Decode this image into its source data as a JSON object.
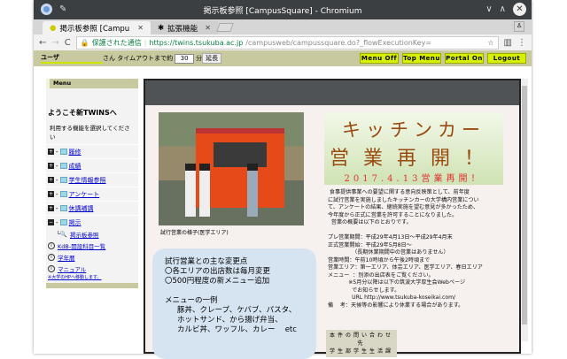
{
  "window": {
    "title": "掲示板参照 [CampusSquare] - Chromium"
  },
  "tabs": [
    {
      "label": "掲示板参照 [Campu"
    },
    {
      "label": "拡張機能"
    }
  ],
  "address": {
    "secure_label": "保護された通信",
    "host": "https://twins.tsukuba.ac.jp",
    "path": "/campusweb/campussquare.do?_flowExecutionKey="
  },
  "header": {
    "user": "ユーザ",
    "san": "さん",
    "timeout_label": "タイムアウトまで約",
    "timeout_value": "30",
    "minutes": "分",
    "extend": "延長",
    "buttons": [
      "Menu Off",
      "Top Menu",
      "Portal On",
      "Logout"
    ]
  },
  "sidebar": {
    "menu": "Menu",
    "welcome": "ようこそ新TWINSへ",
    "instruction": "利用する機能を選択してください",
    "items": [
      "履修",
      "成績",
      "学生情報参照",
      "アンケート",
      "休講補講",
      "掲示"
    ],
    "subitem": "掲示板参照",
    "links": [
      "KdB-開設科目一覧",
      "学年暦",
      "マニュアル"
    ],
    "note": "※大学のHPへ移動します。"
  },
  "content": {
    "caption": "試行営業の様子(医学エリア)",
    "banner": {
      "line1": "キッチンカー",
      "line2": "営業再開！",
      "line3": "2017.4.13営業再開！"
    },
    "body": [
      " 食事提供事業への要望に関する意向反映策として、前年度",
      "に試行営業を実施しましたキッチンカーの大学構内営業につい",
      "て、アンケートの結果、継続実施を望む意見が多かったため、",
      "今年度から正式に営業を許可することになりました。",
      "  営業の概要は以下のとおりです。",
      "",
      "プレ営業期間：平成29年4月13日～平成29年4月末",
      "正式営業開始：平成29年5月8日～",
      "              （長期休業期間中の営業はありません）",
      "営業時間：午前10時頃から午後2時頃まで",
      "営業エリア：第一エリア、体芸エリア、医学エリア、春日エリア",
      "メニュー  ：別添の出店表をご覧ください。",
      "            ※5月分以降は以下の筑波大学厚生会Webページ",
      "              でお知らせします。",
      "              URL http://www.tsukuba-koseikai.com/",
      "備    考：天候等の影響により休業する場合があります。"
    ],
    "contact": [
      "本件の問い合わせ先",
      "学生部学生生活課"
    ],
    "box": [
      "試行営業との主な変更点",
      "〇各エリアの出店数は毎月変更",
      "〇500円程度の新メニュー追加",
      "",
      "メニューの一例"
    ],
    "box_menu": [
      "豚丼、クレープ、ケバブ、パスタ、",
      "ホットサンド、から揚げ弁当、",
      "カルビ丼、ワッフル、カレー　 etc"
    ]
  }
}
